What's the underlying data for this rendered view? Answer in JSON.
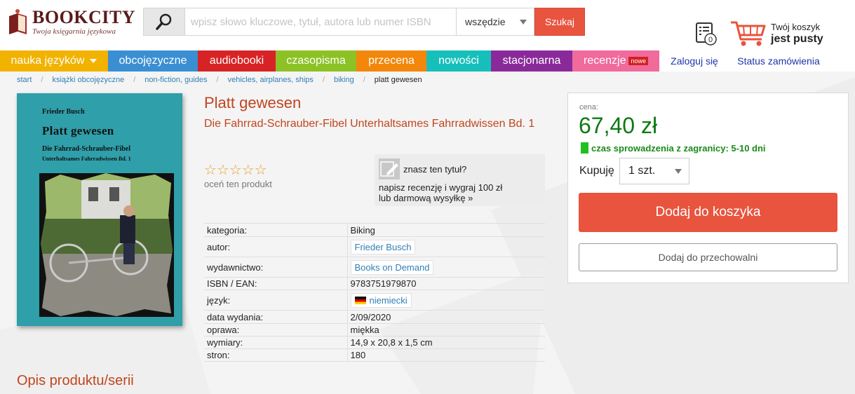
{
  "header": {
    "logo_title": "BOOKCITY",
    "logo_tagline": "Twoja księgarnia językowa",
    "search_placeholder": "wpisz słowo kluczowe, tytuł, autora lub numer ISBN",
    "search_scope": "wszędzie",
    "search_button": "Szukaj",
    "orders_count": "0",
    "cart_label": "Twój koszyk",
    "cart_status": "jest pusty"
  },
  "nav": {
    "items": [
      {
        "label": "nauka języków",
        "color": "#f2b200"
      },
      {
        "label": "obcojęzyczne",
        "color": "#3a8fd3"
      },
      {
        "label": "audiobooki",
        "color": "#d72325"
      },
      {
        "label": "czasopisma",
        "color": "#8cc225"
      },
      {
        "label": "przecena",
        "color": "#f2870b"
      },
      {
        "label": "nowości",
        "color": "#17bfbb"
      },
      {
        "label": "stacjonarna",
        "color": "#8a2a9a"
      },
      {
        "label": "recenzje",
        "color": "#f06a9c",
        "badge": "nowe"
      }
    ],
    "login": "Zaloguj się",
    "order_status": "Status zamówienia"
  },
  "breadcrumb": {
    "items": [
      "start",
      "książki obcojęzyczne",
      "non-fiction, guides",
      "vehicles, airplanes, ships",
      "biking"
    ],
    "current": "platt gewesen"
  },
  "cover": {
    "author": "Frieder Busch",
    "title": "Platt gewesen",
    "subtitle1": "Die Fahrrad-Schrauber-Fibel",
    "subtitle2": "Unterhaltsames Fahrradwissen Bd. 1"
  },
  "product": {
    "title": "Platt gewesen",
    "subtitle": "Die Fahrrad-Schrauber-Fibel Unterhaltsames Fahrradwissen Bd. 1",
    "stars": "☆☆☆☆☆",
    "rating": 0,
    "rate_label": "oceń ten produkt"
  },
  "review": {
    "question": "znasz ten tytuł?",
    "cta_line1": "napisz recenzję i wygraj 100 zł",
    "cta_line2": "lub darmową wysyłkę »"
  },
  "details": {
    "category_k": "kategoria:",
    "category_v": "Biking",
    "author_k": "autor:",
    "author_v": "Frieder Busch",
    "publisher_k": "wydawnictwo:",
    "publisher_v": "Books on Demand",
    "isbn_k": "ISBN / EAN:",
    "isbn_v": "9783751979870",
    "lang_k": "język:",
    "lang_v": "niemiecki",
    "date_k": "data wydania:",
    "date_v": "2/09/2020",
    "binding_k": "oprawa:",
    "binding_v": "miękka",
    "dims_k": "wymiary:",
    "dims_v": "14,9 x 20,8 x 1,5 cm",
    "pages_k": "stron:",
    "pages_v": "180"
  },
  "buy": {
    "price_label": "cena:",
    "price": "67,40 zł",
    "availability": "czas sprowadzenia z zagranicy: 5-10 dni",
    "qty_label": "Kupuję",
    "qty_value": "1 szt.",
    "add_to_cart": "Dodaj do koszyka",
    "add_to_storage": "Dodaj do przechowalni"
  },
  "section": {
    "description_heading": "Opis produktu/serii"
  }
}
